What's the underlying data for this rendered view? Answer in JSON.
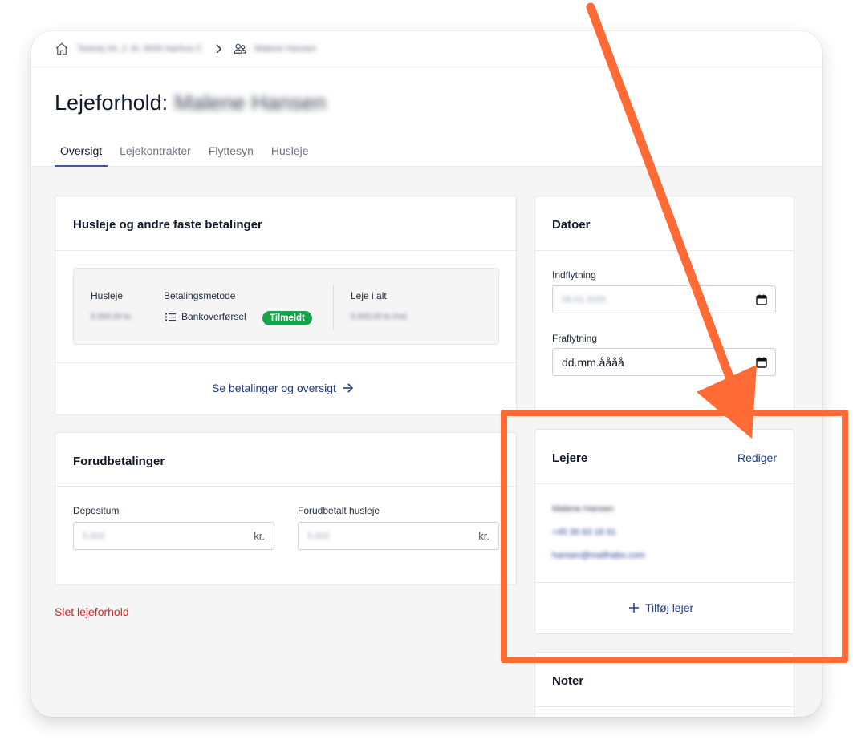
{
  "breadcrumb": {
    "address": "Testvej 44, 2. th, 8000 Aarhus C",
    "tenant": "Malene Hansen"
  },
  "page": {
    "title_prefix": "Lejeforhold:",
    "title_name": "Malene Hansen"
  },
  "tabs": [
    {
      "label": "Oversigt",
      "active": true
    },
    {
      "label": "Lejekontrakter",
      "active": false
    },
    {
      "label": "Flyttesyn",
      "active": false
    },
    {
      "label": "Husleje",
      "active": false
    }
  ],
  "payments": {
    "title": "Husleje og andre faste betalinger",
    "rent_label": "Husleje",
    "rent_value": "5.000,00 kr.",
    "method_label": "Betalingsmetode",
    "method_value": "Bankoverførsel",
    "status_badge": "Tilmeldt",
    "total_label": "Leje i alt",
    "total_value": "5.000,00 kr./md.",
    "link": "Se betalinger og oversigt"
  },
  "prepayments": {
    "title": "Forudbetalinger",
    "deposit_label": "Depositum",
    "deposit_value": "5.000",
    "prepaid_label": "Forudbetalt husleje",
    "prepaid_value": "5.000",
    "currency": "kr."
  },
  "delete_link": "Slet lejeforhold",
  "dates": {
    "title": "Datoer",
    "move_in_label": "Indflytning",
    "move_in_value": "06.01.2025",
    "move_out_label": "Fraflytning",
    "move_out_placeholder": "dd.mm.åååå"
  },
  "tenants": {
    "title": "Lejere",
    "edit": "Rediger",
    "name": "Malene Hansen",
    "phone": "+45 36 63 18 91",
    "email": "hansen@mailhabo.com",
    "add": "Tilføj lejer"
  },
  "notes": {
    "title": "Noter"
  },
  "colors": {
    "annotation": "#ff6a35",
    "link": "#1e3a8a",
    "badge": "#16a34a",
    "danger": "#dc2626"
  }
}
